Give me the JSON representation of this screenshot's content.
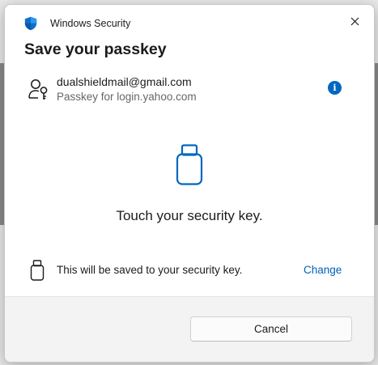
{
  "window": {
    "app_title": "Windows Security",
    "app_icon": "shield-icon",
    "close_icon": "close-icon"
  },
  "dialog": {
    "heading": "Save your passkey"
  },
  "account": {
    "icon": "user-key-icon",
    "email": "dualshieldmail@gmail.com",
    "subtitle": "Passkey for login.yahoo.com",
    "info_icon_glyph": "i"
  },
  "prompt": {
    "icon": "usb-security-key-icon",
    "message": "Touch your security key."
  },
  "destination": {
    "icon": "usb-security-key-icon",
    "message": "This will be saved to your security key.",
    "change_label": "Change"
  },
  "footer": {
    "cancel_label": "Cancel"
  },
  "colors": {
    "accent": "#0067c0",
    "link": "#005fb8",
    "footer_bg": "#f3f3f3"
  }
}
